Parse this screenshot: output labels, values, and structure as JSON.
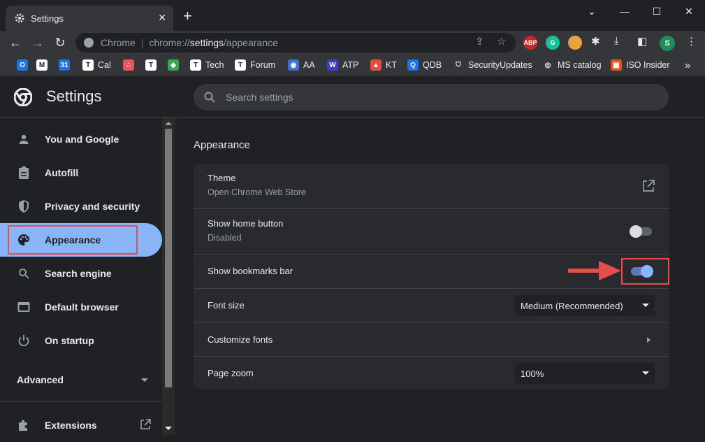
{
  "tab": {
    "title": "Settings",
    "close": "✕"
  },
  "window": {
    "minimize": "⌄",
    "restore": "—",
    "maximize": "☐",
    "close": "✕"
  },
  "omnibox": {
    "chip": "Chrome",
    "host": "chrome://",
    "path_bold": "settings",
    "path_rest": "/appearance"
  },
  "toolbar": {
    "ext_abp": "ABP",
    "ext_g": "G",
    "profile": "S"
  },
  "bookmarks": [
    {
      "label": "",
      "color": "#1a73e8",
      "glyph": "O"
    },
    {
      "label": "",
      "color": "#ffffff",
      "glyph": "M"
    },
    {
      "label": "",
      "color": "#1a73e8",
      "glyph": "31"
    },
    {
      "label": "Cal",
      "color": "#ffffff",
      "glyph": "T"
    },
    {
      "label": "",
      "color": "#e8545e",
      "glyph": "∴"
    },
    {
      "label": "",
      "color": "#ffffff",
      "glyph": "T"
    },
    {
      "label": "",
      "color": "#34a853",
      "glyph": "◆"
    },
    {
      "label": "Tech",
      "color": "#ffffff",
      "glyph": "T"
    },
    {
      "label": "Forum",
      "color": "#ffffff",
      "glyph": "T"
    },
    {
      "label": "AA",
      "color": "#3d6fd1",
      "glyph": "◉"
    },
    {
      "label": "ATP",
      "color": "#3d3dd1",
      "glyph": "W"
    },
    {
      "label": "KT",
      "color": "#e84c3d",
      "glyph": "▲"
    },
    {
      "label": "QDB",
      "color": "#1a73e8",
      "glyph": "Q"
    },
    {
      "label": "SecurityUpdates",
      "color": "#35363a",
      "glyph": "⛉"
    },
    {
      "label": "MS catalog",
      "color": "#35363a",
      "glyph": "◎"
    },
    {
      "label": "ISO Insider",
      "color": "#f25022",
      "glyph": "▦"
    }
  ],
  "bookmarks_overflow": "»",
  "header": {
    "title": "Settings",
    "search_placeholder": "Search settings"
  },
  "sidebar": {
    "items": [
      {
        "label": "You and Google",
        "icon": "person-icon"
      },
      {
        "label": "Autofill",
        "icon": "clipboard-icon"
      },
      {
        "label": "Privacy and security",
        "icon": "shield-icon"
      },
      {
        "label": "Appearance",
        "icon": "palette-icon"
      },
      {
        "label": "Search engine",
        "icon": "search-icon"
      },
      {
        "label": "Default browser",
        "icon": "browser-icon"
      },
      {
        "label": "On startup",
        "icon": "power-icon"
      }
    ],
    "advanced": "Advanced",
    "extensions": "Extensions"
  },
  "main": {
    "section_title": "Appearance",
    "theme": {
      "label": "Theme",
      "sub": "Open Chrome Web Store"
    },
    "home_button": {
      "label": "Show home button",
      "sub": "Disabled",
      "enabled": false
    },
    "bookmarks_bar": {
      "label": "Show bookmarks bar",
      "enabled": true
    },
    "font_size": {
      "label": "Font size",
      "value": "Medium (Recommended)"
    },
    "customize_fonts": {
      "label": "Customize fonts"
    },
    "page_zoom": {
      "label": "Page zoom",
      "value": "100%"
    }
  },
  "colors": {
    "accent": "#8ab4f8",
    "highlight": "#e84c4c",
    "bg": "#202124",
    "card": "#292a2d"
  }
}
